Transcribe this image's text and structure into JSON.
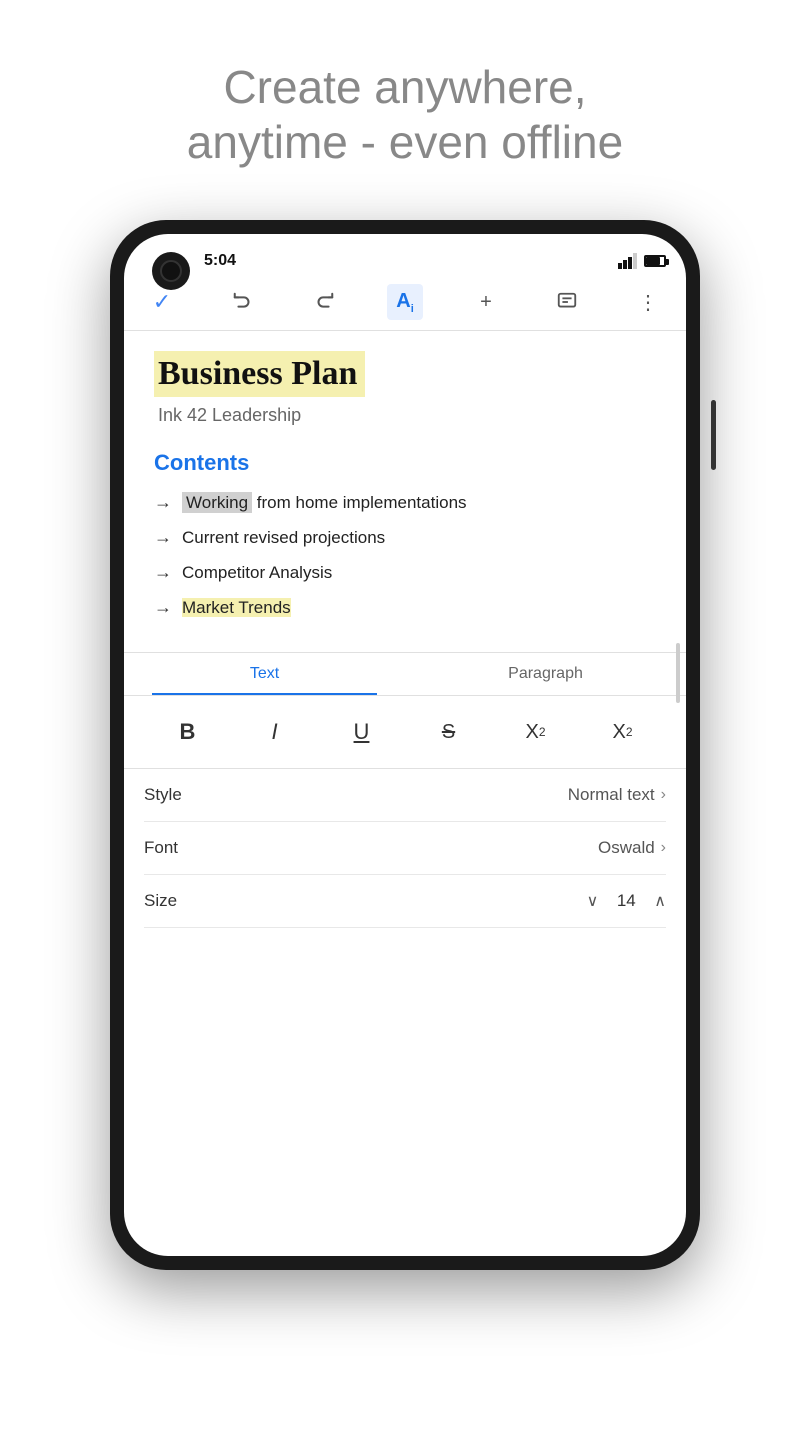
{
  "tagline": {
    "line1": "Create anywhere,",
    "line2": "anytime - even offline"
  },
  "status": {
    "time": "5:04"
  },
  "toolbar": {
    "check_label": "✓",
    "undo_label": "↩",
    "redo_label": "↪",
    "text_format_label": "Aᵢ",
    "add_label": "+",
    "comment_label": "💬",
    "more_label": "⋮"
  },
  "document": {
    "title": "Business Plan",
    "subtitle": "Ink 42 Leadership",
    "heading": "Contents",
    "list": [
      {
        "text": "Working from home implementations",
        "highlight": "Working"
      },
      {
        "text": "Current revised projections",
        "highlight": ""
      },
      {
        "text": "Competitor Analysis",
        "highlight": ""
      },
      {
        "text": "Market Trends",
        "highlight": "Market Trends",
        "yellow": true
      }
    ]
  },
  "format_panel": {
    "tabs": [
      {
        "label": "Text",
        "active": true
      },
      {
        "label": "Paragraph",
        "active": false
      }
    ],
    "buttons": [
      {
        "label": "B",
        "type": "bold"
      },
      {
        "label": "I",
        "type": "italic"
      },
      {
        "label": "U",
        "type": "underline"
      },
      {
        "label": "S",
        "type": "strikethrough"
      },
      {
        "label": "X²",
        "type": "superscript"
      },
      {
        "label": "X₂",
        "type": "subscript"
      }
    ],
    "style_label": "Style",
    "style_value": "Normal text",
    "font_label": "Font",
    "font_value": "Oswald",
    "size_label": "Size",
    "size_value": "14"
  }
}
